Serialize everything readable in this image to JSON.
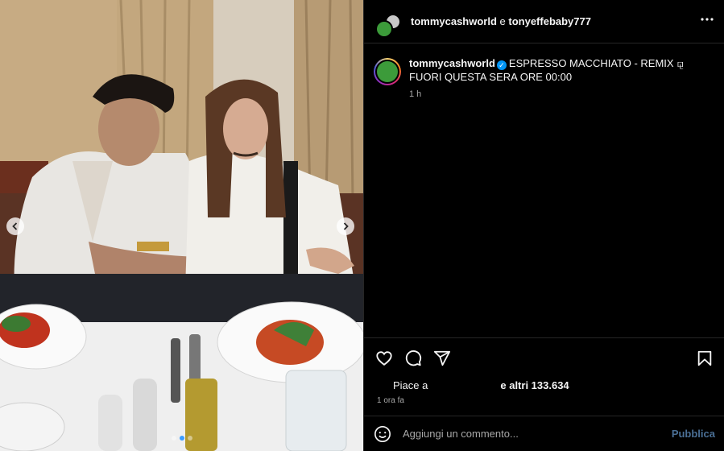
{
  "header": {
    "user1": "tommycashworld",
    "joiner": " e ",
    "user2": "tonyeffebaby777",
    "more_icon": "more-horizontal-icon"
  },
  "caption": {
    "username": "tommycashworld",
    "verified_icon": "verified-badge-icon",
    "text": "ESPRESSO MACCHIATO - REMIX ⚼ FUORI QUESTA SERA ORE 00:00",
    "time": "1 h"
  },
  "actions": {
    "like_icon": "heart-icon",
    "comment_icon": "comment-icon",
    "share_icon": "share-icon",
    "save_icon": "bookmark-icon"
  },
  "likes": {
    "prefix": "Piace a",
    "suffix": "e altri 133.634"
  },
  "post_time": "1 ora fa",
  "comment": {
    "placeholder": "Aggiungi un commento...",
    "publish_label": "Pubblica",
    "emoji_icon": "emoji-icon"
  },
  "carousel": {
    "slide_count": 3,
    "active_index": 1,
    "prev_icon": "chevron-left-icon",
    "next_icon": "chevron-right-icon"
  },
  "colors": {
    "background": "#000000",
    "accent_blue": "#0095f6",
    "publish_disabled": "#4a6f95",
    "secondary_text": "#a8a8a8"
  }
}
